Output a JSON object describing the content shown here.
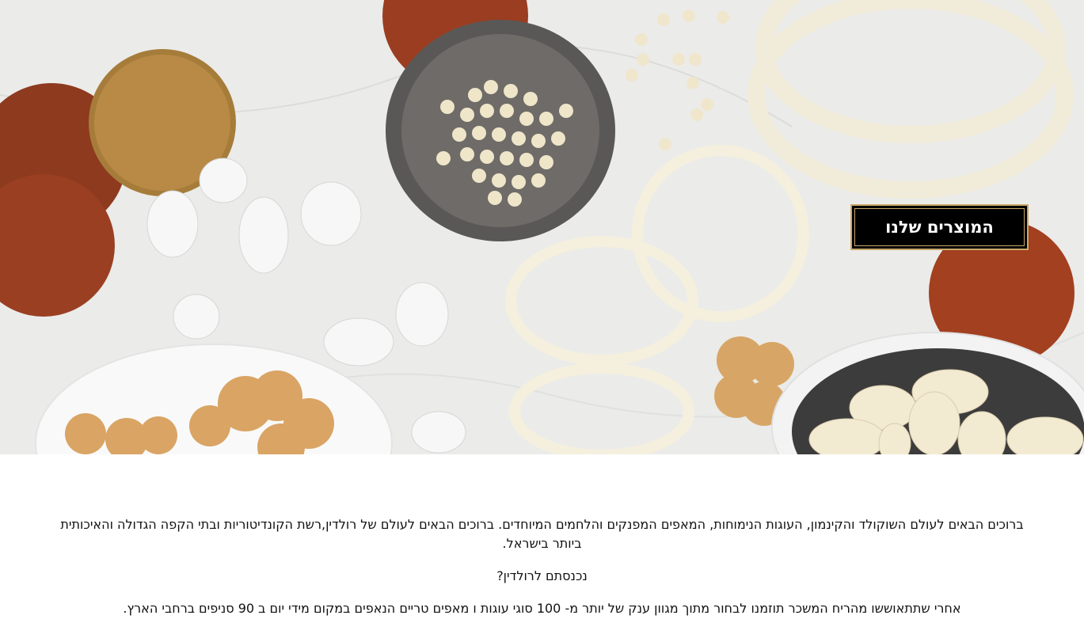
{
  "hero": {
    "cta_label": "המוצרים שלנו"
  },
  "content": {
    "intro": "ברוכים הבאים לעולם השוקולד והקינמון, העוגות הנימוחות, המאפים המפנקים והלחמים המיוחדים. ברוכים הבאים לעולם של רולדין,רשת הקונדיטוריות ובתי הקפה הגדולה והאיכותית ביותר בישראל.",
    "question": "נכנסתם לרולדין?",
    "body": "אחרי שתתאוששו מהריח המשכר תוזמנו לבחור מתוך מגוון ענק של יותר מ- 100 סוגי עוגות ו מאפים טריים הנאפים במקום מידי יום ב 90 סניפים ברחבי הארץ."
  },
  "colors": {
    "cta_background": "#000000",
    "cta_border": "#c9a86a",
    "cta_text": "#ffffff"
  }
}
